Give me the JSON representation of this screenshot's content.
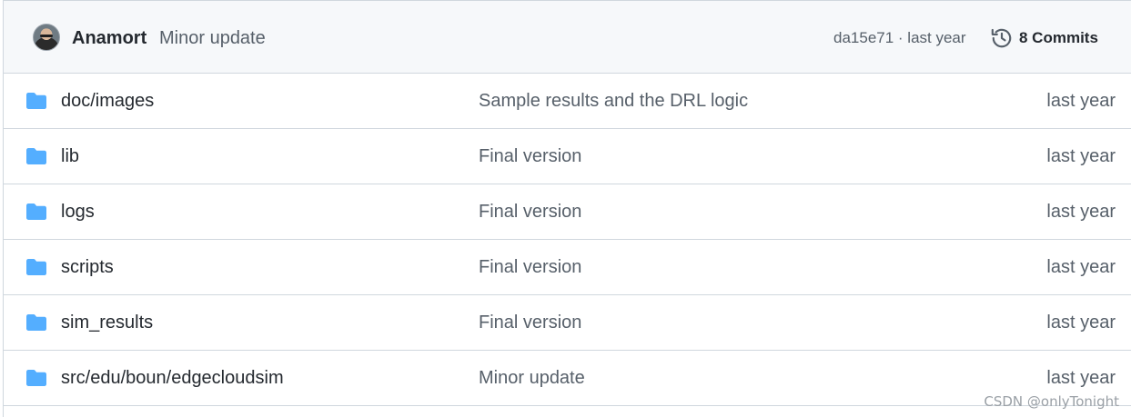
{
  "latest_commit": {
    "author": "Anamort",
    "message": "Minor update",
    "hash": "da15e71",
    "separator": " · ",
    "time": "last year",
    "commits_label": "8 Commits"
  },
  "files": [
    {
      "name": "doc/images",
      "message": "Sample results and the DRL logic",
      "age": "last year",
      "icon": "folder-icon"
    },
    {
      "name": "lib",
      "message": "Final version",
      "age": "last year",
      "icon": "folder-icon"
    },
    {
      "name": "logs",
      "message": "Final version",
      "age": "last year",
      "icon": "folder-icon"
    },
    {
      "name": "scripts",
      "message": "Final version",
      "age": "last year",
      "icon": "folder-icon"
    },
    {
      "name": "sim_results",
      "message": "Final version",
      "age": "last year",
      "icon": "folder-icon"
    },
    {
      "name": "src/edu/boun/edgecloudsim",
      "message": "Minor update",
      "age": "last year",
      "icon": "folder-icon"
    }
  ],
  "watermark": "CSDN @onlyTonight",
  "colors": {
    "folder": "#54aeff",
    "header_bg": "#f6f8fa",
    "border": "#d0d7de",
    "text_primary": "#24292f",
    "text_muted": "#57606a"
  }
}
